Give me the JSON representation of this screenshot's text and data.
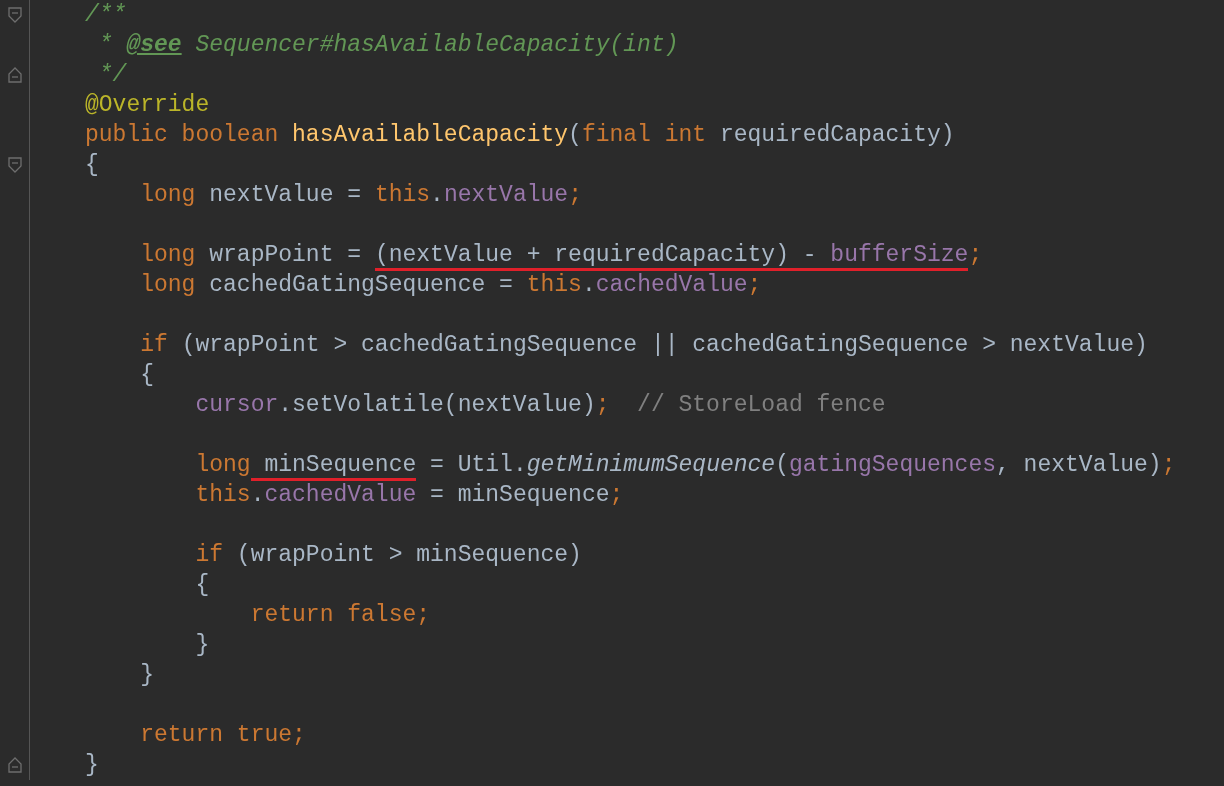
{
  "editor": {
    "lines": [
      {
        "fold_start": true,
        "tokens": [
          {
            "text": "/**",
            "kind": "doc"
          }
        ]
      },
      {
        "tokens": [
          {
            "text": " * ",
            "kind": "doc"
          },
          {
            "text": "@see",
            "kind": "doctag"
          },
          {
            "text": " Sequencer#hasAvailableCapacity(int)",
            "kind": "doc"
          }
        ]
      },
      {
        "fold_end": true,
        "tokens": [
          {
            "text": " */",
            "kind": "doc"
          }
        ]
      },
      {
        "tokens": [
          {
            "text": "@Override",
            "kind": "annotation"
          }
        ]
      },
      {
        "tokens": [
          {
            "text": "public boolean ",
            "kind": "keyword"
          },
          {
            "text": "hasAvailableCapacity",
            "kind": "method"
          },
          {
            "text": "(",
            "kind": "plain"
          },
          {
            "text": "final int ",
            "kind": "keyword"
          },
          {
            "text": "requiredCapacity)",
            "kind": "plain"
          }
        ]
      },
      {
        "fold_start": true,
        "tokens": [
          {
            "text": "{",
            "kind": "plain"
          }
        ]
      },
      {
        "tokens": [
          {
            "text": "    long ",
            "kind": "keyword"
          },
          {
            "text": "nextValue = ",
            "kind": "plain"
          },
          {
            "text": "this",
            "kind": "keyword"
          },
          {
            "text": ".",
            "kind": "plain"
          },
          {
            "text": "nextValue",
            "kind": "field"
          },
          {
            "text": ";",
            "kind": "keyword"
          }
        ]
      },
      {
        "blank_before": true,
        "tokens": [
          {
            "text": "    long ",
            "kind": "keyword"
          },
          {
            "text": "wrapPoint = ",
            "kind": "plain"
          },
          {
            "text": "(nextValue + requiredCapacity) - ",
            "kind": "plain",
            "marked": true
          },
          {
            "text": "bufferSize",
            "kind": "field",
            "marked": true
          },
          {
            "text": ";",
            "kind": "keyword"
          }
        ]
      },
      {
        "tokens": [
          {
            "text": "    long ",
            "kind": "keyword"
          },
          {
            "text": "cachedGatingSequence = ",
            "kind": "plain"
          },
          {
            "text": "this",
            "kind": "keyword"
          },
          {
            "text": ".",
            "kind": "plain"
          },
          {
            "text": "cachedValue",
            "kind": "field"
          },
          {
            "text": ";",
            "kind": "keyword"
          }
        ]
      },
      {
        "blank_before": true,
        "tokens": [
          {
            "text": "    if ",
            "kind": "keyword"
          },
          {
            "text": "(wrapPoint > cachedGatingSequence || cachedGatingSequence > nextValue)",
            "kind": "plain"
          }
        ]
      },
      {
        "tokens": [
          {
            "text": "    {",
            "kind": "plain"
          }
        ]
      },
      {
        "tokens": [
          {
            "text": "        cursor",
            "kind": "field"
          },
          {
            "text": ".setVolatile(nextValue)",
            "kind": "plain"
          },
          {
            "text": ";  ",
            "kind": "keyword"
          },
          {
            "text": "// StoreLoad fence",
            "kind": "comment"
          }
        ]
      },
      {
        "blank_before": true,
        "tokens": [
          {
            "text": "        long",
            "kind": "keyword"
          },
          {
            "text": " minSequence",
            "kind": "plain",
            "marked": true
          },
          {
            "text": " = Util.",
            "kind": "plain"
          },
          {
            "text": "getMinimumSequence",
            "kind": "static"
          },
          {
            "text": "(",
            "kind": "plain"
          },
          {
            "text": "gatingSequences",
            "kind": "field"
          },
          {
            "text": ", nextValue)",
            "kind": "plain"
          },
          {
            "text": ";",
            "kind": "keyword"
          }
        ]
      },
      {
        "tokens": [
          {
            "text": "        this",
            "kind": "keyword"
          },
          {
            "text": ".",
            "kind": "plain"
          },
          {
            "text": "cachedValue",
            "kind": "field"
          },
          {
            "text": " = minSequence",
            "kind": "plain"
          },
          {
            "text": ";",
            "kind": "keyword"
          }
        ]
      },
      {
        "blank_before": true,
        "tokens": [
          {
            "text": "        if ",
            "kind": "keyword"
          },
          {
            "text": "(wrapPoint > minSequence)",
            "kind": "plain"
          }
        ]
      },
      {
        "tokens": [
          {
            "text": "        {",
            "kind": "plain"
          }
        ]
      },
      {
        "tokens": [
          {
            "text": "            return false;",
            "kind": "keyword"
          }
        ]
      },
      {
        "tokens": [
          {
            "text": "        }",
            "kind": "plain"
          }
        ]
      },
      {
        "tokens": [
          {
            "text": "    }",
            "kind": "plain"
          }
        ]
      },
      {
        "blank_before": true,
        "tokens": [
          {
            "text": "    return true;",
            "kind": "keyword"
          }
        ]
      },
      {
        "fold_end": true,
        "tokens": [
          {
            "text": "}",
            "kind": "plain"
          }
        ]
      }
    ]
  }
}
